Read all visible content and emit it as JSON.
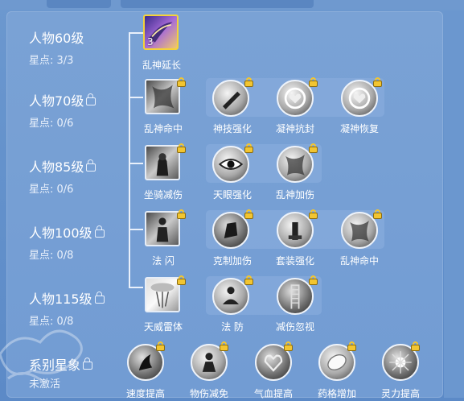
{
  "levels": [
    {
      "title": "人物60级",
      "progress": "星点: 3/3",
      "locked": false
    },
    {
      "title": "人物70级",
      "progress": "星点: 0/6",
      "locked": true
    },
    {
      "title": "人物85级",
      "progress": "星点: 0/6",
      "locked": true
    },
    {
      "title": "人物100级",
      "progress": "星点: 0/8",
      "locked": true
    },
    {
      "title": "人物115级",
      "progress": "星点: 0/8",
      "locked": true
    }
  ],
  "zodiac": {
    "title": "系别星象",
    "status": "未激活",
    "locked": true
  },
  "skills": {
    "row1": [
      {
        "name": "乱神延长",
        "count": "3",
        "icon": "purple-slash-icon"
      }
    ],
    "row2": [
      {
        "name": "乱神命中",
        "icon": "cloak-icon"
      },
      {
        "name": "神技强化",
        "icon": "brush-icon"
      },
      {
        "name": "凝神抗封",
        "icon": "heart-ring-icon"
      },
      {
        "name": "凝神恢复",
        "icon": "heart-ring-icon"
      }
    ],
    "row3": [
      {
        "name": "坐骑减伤",
        "icon": "dark-warrior-icon"
      },
      {
        "name": "天眼强化",
        "icon": "eye-icon"
      },
      {
        "name": "乱神加伤",
        "icon": "cloak-icon"
      }
    ],
    "row4": [
      {
        "name": "法 闪",
        "icon": "figure-icon"
      },
      {
        "name": "克制加伤",
        "icon": "fist-icon"
      },
      {
        "name": "套装强化",
        "icon": "statue-icon"
      },
      {
        "name": "乱神命中",
        "icon": "cloak-icon"
      }
    ],
    "row5": [
      {
        "name": "天威雷体",
        "icon": "lightning-cloud-icon"
      },
      {
        "name": "法 防",
        "icon": "meditation-icon"
      },
      {
        "name": "减伤忽视",
        "icon": "stairs-icon"
      }
    ],
    "row6": [
      {
        "name": "速度提高",
        "icon": "runner-icon"
      },
      {
        "name": "物伤减免",
        "icon": "shield-figure-icon"
      },
      {
        "name": "气血提高",
        "icon": "heart-icon"
      },
      {
        "name": "药格增加",
        "icon": "gem-icon"
      },
      {
        "name": "灵力提高",
        "icon": "star-burst-icon"
      }
    ]
  },
  "colors": {
    "panel": "#7aa2d5",
    "background": "#5f8dc6",
    "lock": "#f2c531",
    "active_border": "#f4d23a"
  }
}
